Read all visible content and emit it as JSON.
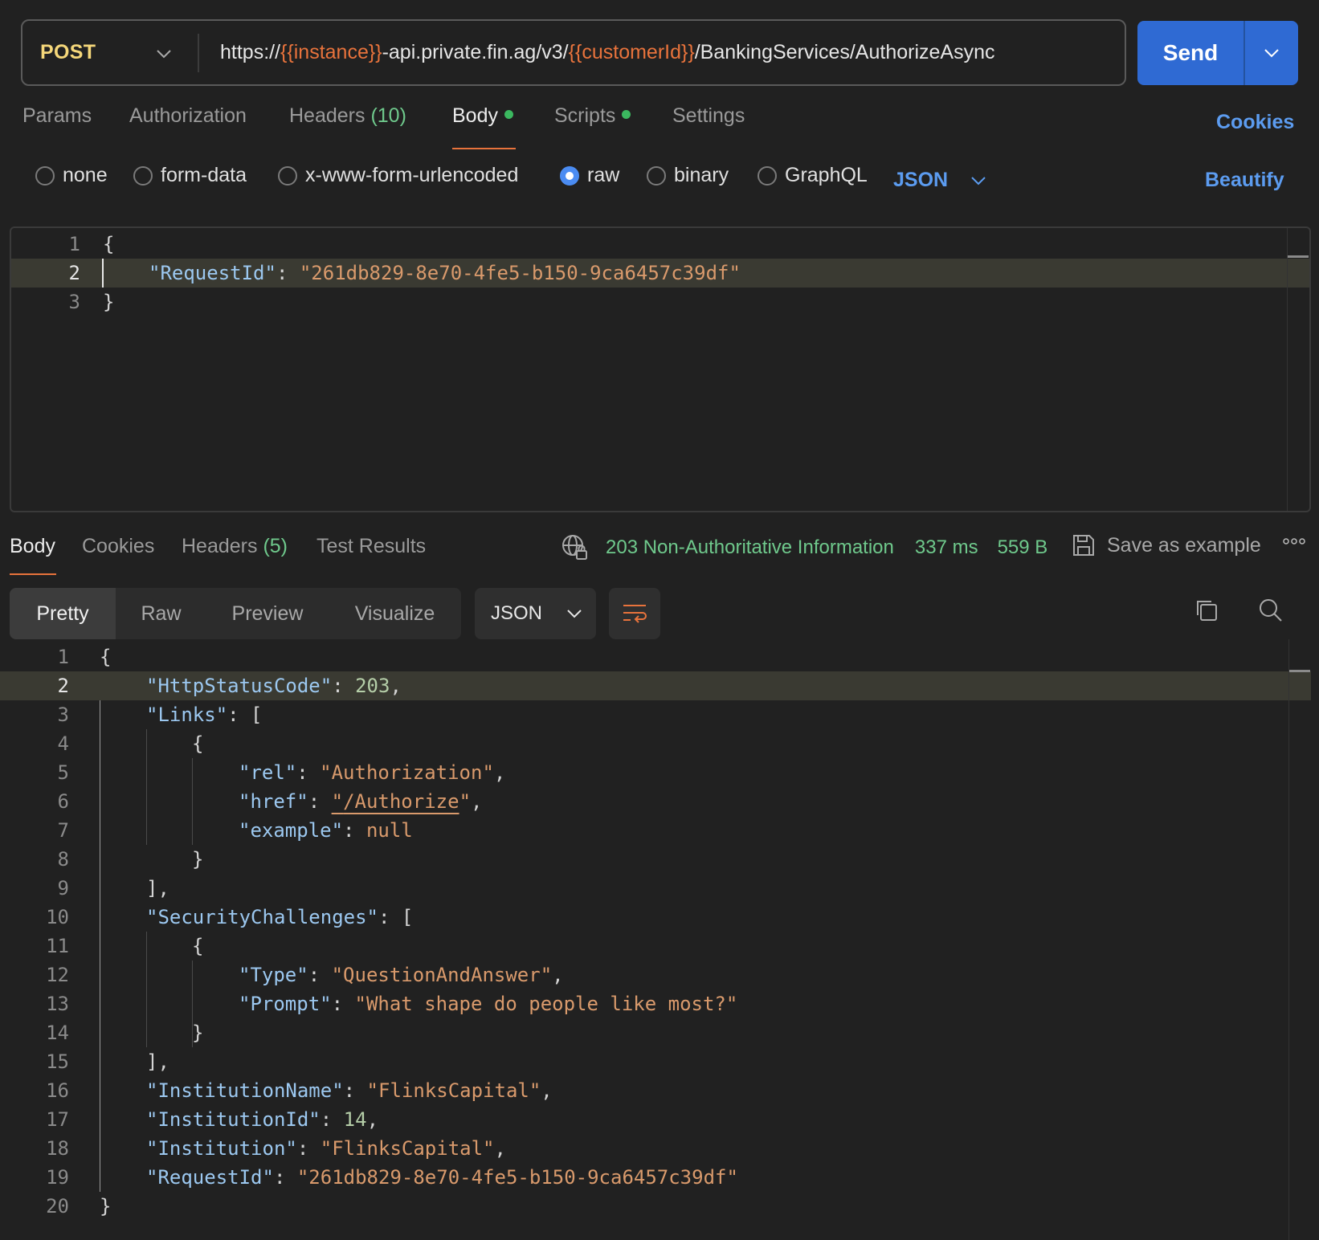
{
  "request": {
    "method": "POST",
    "url_parts": {
      "p1": "https://",
      "var1": "{{instance}}",
      "p2": "-api.private.fin.ag/v3/",
      "var2": "{{customerId}}",
      "p3": "/BankingServices/AuthorizeAsync"
    },
    "send_label": "Send",
    "tabs": {
      "params": "Params",
      "authorization": "Authorization",
      "headers": "Headers",
      "headers_count": "(10)",
      "body": "Body",
      "scripts": "Scripts",
      "settings": "Settings"
    },
    "cookies_label": "Cookies",
    "body_types": {
      "none": "none",
      "form_data": "form-data",
      "urlencoded": "x-www-form-urlencoded",
      "raw": "raw",
      "binary": "binary",
      "graphql": "GraphQL"
    },
    "selected_body_type": "raw",
    "format": "JSON",
    "beautify_label": "Beautify",
    "lines": {
      "l1": "{",
      "l2_key": "\"RequestId\"",
      "l2_colon": ": ",
      "l2_val": "\"261db829-8e70-4fe5-b150-9ca6457c39df\"",
      "l3": "}"
    },
    "line_numbers": [
      "1",
      "2",
      "3"
    ]
  },
  "response": {
    "tabs": {
      "body": "Body",
      "cookies": "Cookies",
      "headers": "Headers",
      "headers_count": "(5)",
      "test_results": "Test Results"
    },
    "status_text": "203 Non-Authoritative Information",
    "time": "337 ms",
    "size": "559 B",
    "save_example": "Save as example",
    "views": {
      "pretty": "Pretty",
      "raw": "Raw",
      "preview": "Preview",
      "visualize": "Visualize"
    },
    "format": "JSON",
    "line_numbers": [
      "1",
      "2",
      "3",
      "4",
      "5",
      "6",
      "7",
      "8",
      "9",
      "10",
      "11",
      "12",
      "13",
      "14",
      "15",
      "16",
      "17",
      "18",
      "19",
      "20"
    ],
    "code": {
      "open": "{",
      "http_key": "\"HttpStatusCode\"",
      "http_val": "203",
      "links_key": "\"Links\"",
      "rel_key": "\"rel\"",
      "rel_val": "\"Authorization\"",
      "href_key": "\"href\"",
      "href_q1": "\"",
      "href_val": "/Authorize",
      "href_q2": "\"",
      "example_key": "\"example\"",
      "example_val": "null",
      "sec_key": "\"SecurityChallenges\"",
      "type_key": "\"Type\"",
      "type_val": "\"QuestionAndAnswer\"",
      "prompt_key": "\"Prompt\"",
      "prompt_val": "\"What shape do people like most?\"",
      "instname_key": "\"InstitutionName\"",
      "instname_val": "\"FlinksCapital\"",
      "instid_key": "\"InstitutionId\"",
      "instid_val": "14",
      "inst_key": "\"Institution\"",
      "inst_val": "\"FlinksCapital\"",
      "reqid_key": "\"RequestId\"",
      "reqid_val": "\"261db829-8e70-4fe5-b150-9ca6457c39df\"",
      "close": "}"
    }
  },
  "colors": {
    "background": "#212121",
    "accent_blue": "#2f6ad3",
    "link_blue": "#5c9cf0",
    "status_green": "#6fc98c",
    "method_yellow": "#f5d77a",
    "variable_orange": "#e8733c",
    "string_orange": "#d99a6c",
    "key_blue": "#9cc8f0"
  }
}
